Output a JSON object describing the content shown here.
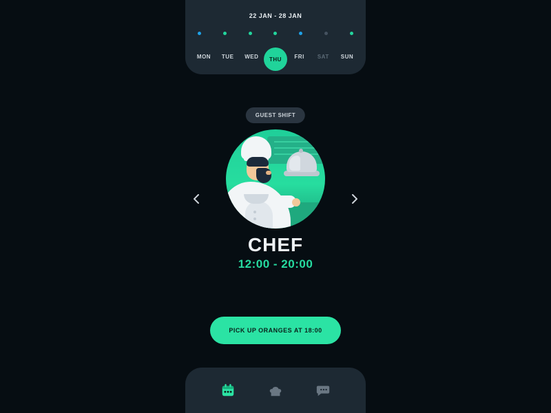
{
  "header": {
    "date_range": "22 JAN - 28 JAN",
    "days": [
      "MON",
      "TUE",
      "WED",
      "THU",
      "FRI",
      "SAT",
      "SUN"
    ],
    "selected_day_index": 3,
    "dim_day_indices": [
      5
    ],
    "dot_colors": [
      "#1fa2e8",
      "#23d59d",
      "#23d59d",
      "#23d59d",
      "#1fa2e8",
      "#455260",
      "#23d59d"
    ]
  },
  "badge": {
    "label": "GUEST SHIFT"
  },
  "shift": {
    "role": "CHEF",
    "hours": "12:00 - 20:00"
  },
  "cta": {
    "label": "PICK UP ORANGES AT 18:00"
  },
  "colors": {
    "accent": "#20d39a"
  }
}
